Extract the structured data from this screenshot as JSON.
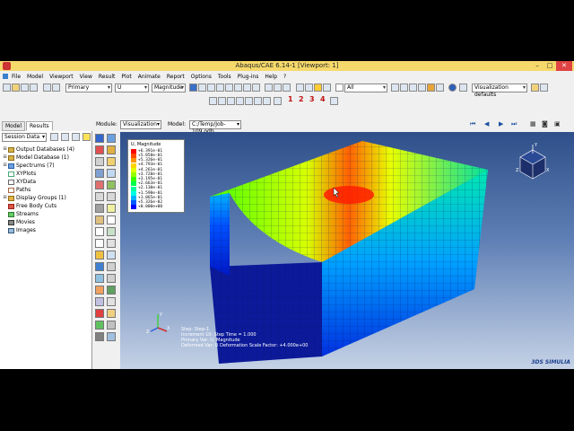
{
  "window": {
    "title": "Abaqus/CAE 6.14-1 [Viewport: 1]",
    "minimize": "–",
    "maximize": "□",
    "close": "✕"
  },
  "menu": [
    "File",
    "Model",
    "Viewport",
    "View",
    "Result",
    "Plot",
    "Animate",
    "Report",
    "Options",
    "Tools",
    "Plug-ins",
    "Help",
    "?"
  ],
  "toolbar": {
    "step_select": "Primary",
    "variable_select": "U",
    "invariant_select": "Magnitude",
    "all_select": "All",
    "render_select": "Visualization defaults",
    "view_numbers": [
      "1",
      "2",
      "3",
      "4"
    ]
  },
  "tabs": {
    "model": "Model",
    "results": "Results"
  },
  "context": {
    "module_label": "Module:",
    "module_value": "Visualization",
    "model_label": "Model:",
    "model_value": "C:/Temp/Job-109.odb"
  },
  "session": {
    "select": "Session Data"
  },
  "tree": [
    {
      "label": "Output Databases (4)",
      "expanded": true,
      "leaf": false
    },
    {
      "label": "Model Database (1)",
      "expanded": true,
      "leaf": false
    },
    {
      "label": "Spectrums (7)",
      "expanded": true,
      "leaf": false
    },
    {
      "label": "XYPlots",
      "leaf": true
    },
    {
      "label": "XYData",
      "leaf": true
    },
    {
      "label": "Paths",
      "leaf": true
    },
    {
      "label": "Display Groups (1)",
      "expanded": true,
      "leaf": false
    },
    {
      "label": "Free Body Cuts",
      "leaf": true
    },
    {
      "label": "Streams",
      "leaf": true
    },
    {
      "label": "Movies",
      "leaf": true
    },
    {
      "label": "Images",
      "leaf": true
    }
  ],
  "legend": {
    "title": "U, Magnitude",
    "entries": [
      {
        "value": "+6.391e-01",
        "color": "#ff0000"
      },
      {
        "value": "+5.858e-01",
        "color": "#ff4a00"
      },
      {
        "value": "+5.326e-01",
        "color": "#ff9400"
      },
      {
        "value": "+4.793e-01",
        "color": "#ffd500"
      },
      {
        "value": "+4.261e-01",
        "color": "#e0ff00"
      },
      {
        "value": "+3.728e-01",
        "color": "#94ff00"
      },
      {
        "value": "+3.195e-01",
        "color": "#3cff00"
      },
      {
        "value": "+2.663e-01",
        "color": "#00ff4a"
      },
      {
        "value": "+2.130e-01",
        "color": "#00ff9c"
      },
      {
        "value": "+1.598e-01",
        "color": "#00ffe8"
      },
      {
        "value": "+1.065e-01",
        "color": "#00b4ff"
      },
      {
        "value": "+5.326e-02",
        "color": "#005aff"
      },
      {
        "value": "+0.000e+00",
        "color": "#0000ff"
      }
    ]
  },
  "info": {
    "line1": "Step: Step-1",
    "line2": "Increment     10: Step Time =    1.000",
    "line3": "Primary Var: U, Magnitude",
    "line4": "Deformed Var: U   Deformation Scale Factor: +4.000e+00"
  },
  "brand": "3DS SIMULIA",
  "triad": {
    "x": "X",
    "y": "Y",
    "z": "Z"
  },
  "cube": {
    "y": "Y",
    "x": "X",
    "z": "Z"
  }
}
